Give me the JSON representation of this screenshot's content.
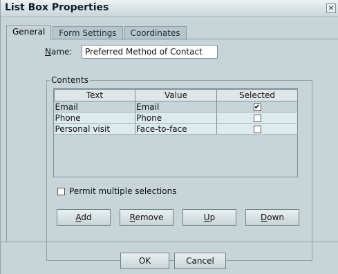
{
  "window": {
    "title": "List Box Properties"
  },
  "tabs": [
    {
      "label": "General",
      "active": true
    },
    {
      "label": "Form Settings",
      "active": false
    },
    {
      "label": "Coordinates",
      "active": false
    }
  ],
  "name_field": {
    "label_rest": "ame:",
    "label_mnemonic": "N",
    "value": "Preferred Method of Contact"
  },
  "contents": {
    "group_label": "Contents",
    "columns": [
      "Text",
      "Value",
      "Selected"
    ],
    "rows": [
      {
        "text": "Email",
        "value": "Email",
        "selected": true
      },
      {
        "text": "Phone",
        "value": "Phone",
        "selected": false
      },
      {
        "text": "Personal visit",
        "value": "Face-to-face",
        "selected": false
      }
    ],
    "permit_multiple_label": "Permit multiple selections",
    "permit_multiple_checked": false,
    "buttons": [
      {
        "mnemonic": "A",
        "rest": "dd"
      },
      {
        "mnemonic": "R",
        "rest": "emove"
      },
      {
        "mnemonic": "U",
        "rest": "p"
      },
      {
        "mnemonic": "D",
        "rest": "own"
      }
    ]
  },
  "footer": {
    "ok_label": "OK",
    "cancel_label": "Cancel"
  },
  "colors": {
    "dialog_bg": "#c7d5d9",
    "row_highlight": "#ddebee",
    "header_bg": "#dfe6e8"
  },
  "icons": {
    "close": "close-icon",
    "check": "checkmark-icon"
  }
}
